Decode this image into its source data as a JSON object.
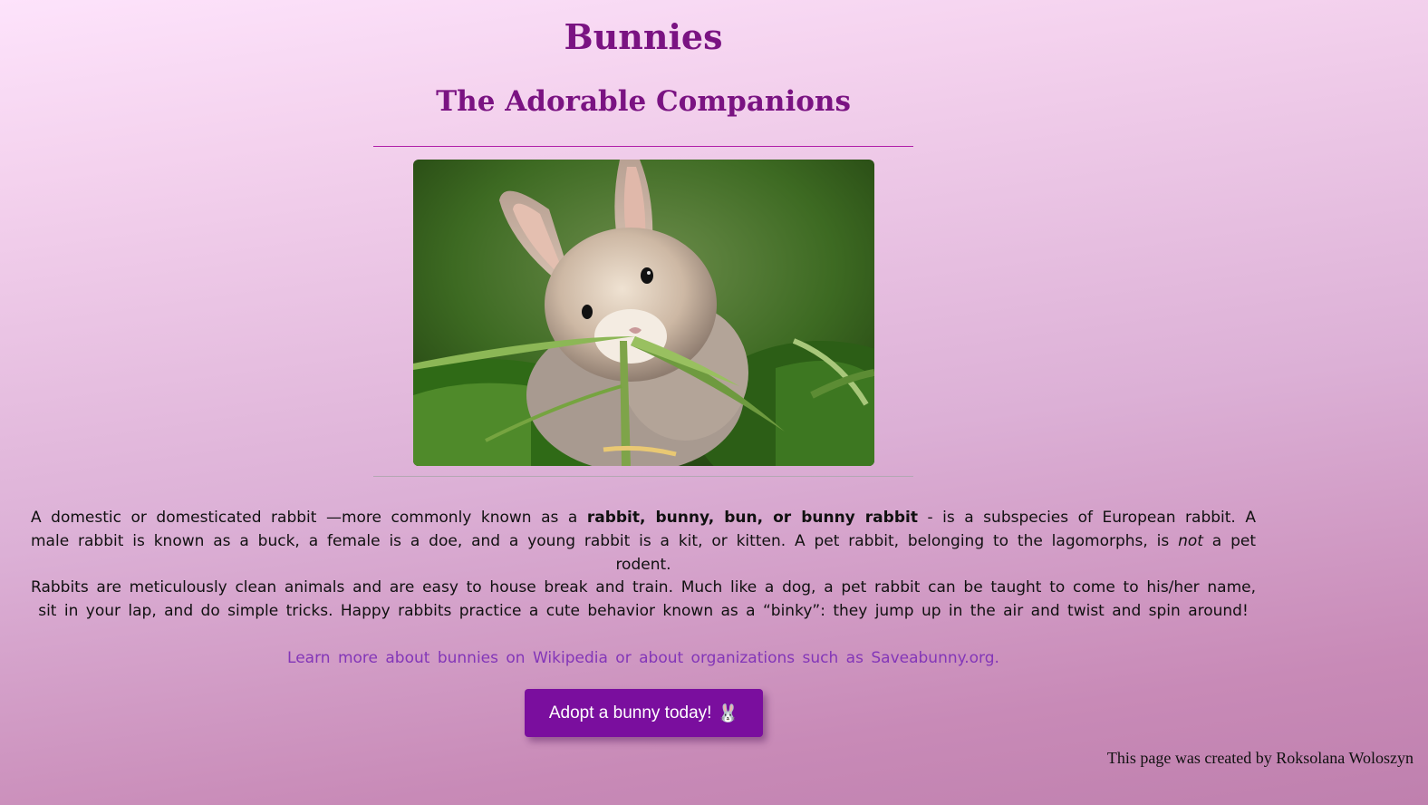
{
  "header": {
    "title": "Bunnies",
    "subtitle": "The Adorable Companions"
  },
  "hero_image": {
    "alt": "bunny-photo",
    "icon": "rabbit-eating-grass-photo"
  },
  "intro": {
    "p1_a": "A domestic or domesticated rabbit —more commonly known as a ",
    "p1_bold": "rabbit, bunny, bun, or bunny rabbit",
    "p1_b": " - is a subspecies of European rabbit. A male rabbit is known as a buck, a female is a doe, and a young rabbit is a kit, or kitten. A pet rabbit, belonging to the lagomorphs, is ",
    "p1_italic": "not",
    "p1_c": " a pet rodent.",
    "p2": "Rabbits are meticulously clean animals and are easy to house break and train. Much like a dog, a pet rabbit can be taught to come to his/her name, sit in your lap, and do simple tricks. Happy rabbits practice a cute behavior known as a “binky”: they jump up in the air and twist and spin around!"
  },
  "links": {
    "prefix": "Learn more about bunnies on ",
    "wikipedia": "Wikipedia",
    "middle": " or about organizations such as ",
    "saveabunny": "Saveabunny.org",
    "suffix": "."
  },
  "cta": {
    "label": "Adopt a bunny today!",
    "emoji": "🐰",
    "icon": "rabbit-face-icon",
    "color": "#7a0e9e"
  },
  "footer": {
    "credit": "This page was created by Roksolana Woloszyn"
  },
  "colors": {
    "heading": "#7a1382",
    "link": "#8336b8"
  }
}
